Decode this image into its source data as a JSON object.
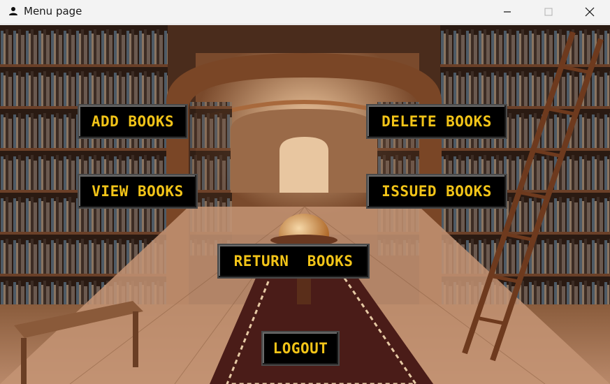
{
  "window": {
    "title": "Menu page",
    "icon": "user-icon",
    "controls": [
      "minimize-icon",
      "maximize-icon",
      "close-icon"
    ]
  },
  "menu": {
    "add_books": "ADD BOOKS",
    "delete_books": "DELETE BOOKS",
    "view_books": "VIEW BOOKS",
    "issued_books": "ISSUED BOOKS",
    "return_books": "RETURN  BOOKS",
    "logout": "LOGOUT"
  },
  "colors": {
    "button_bg": "#000000",
    "button_text": "#f2c418",
    "titlebar_bg": "#f3f3f3"
  }
}
